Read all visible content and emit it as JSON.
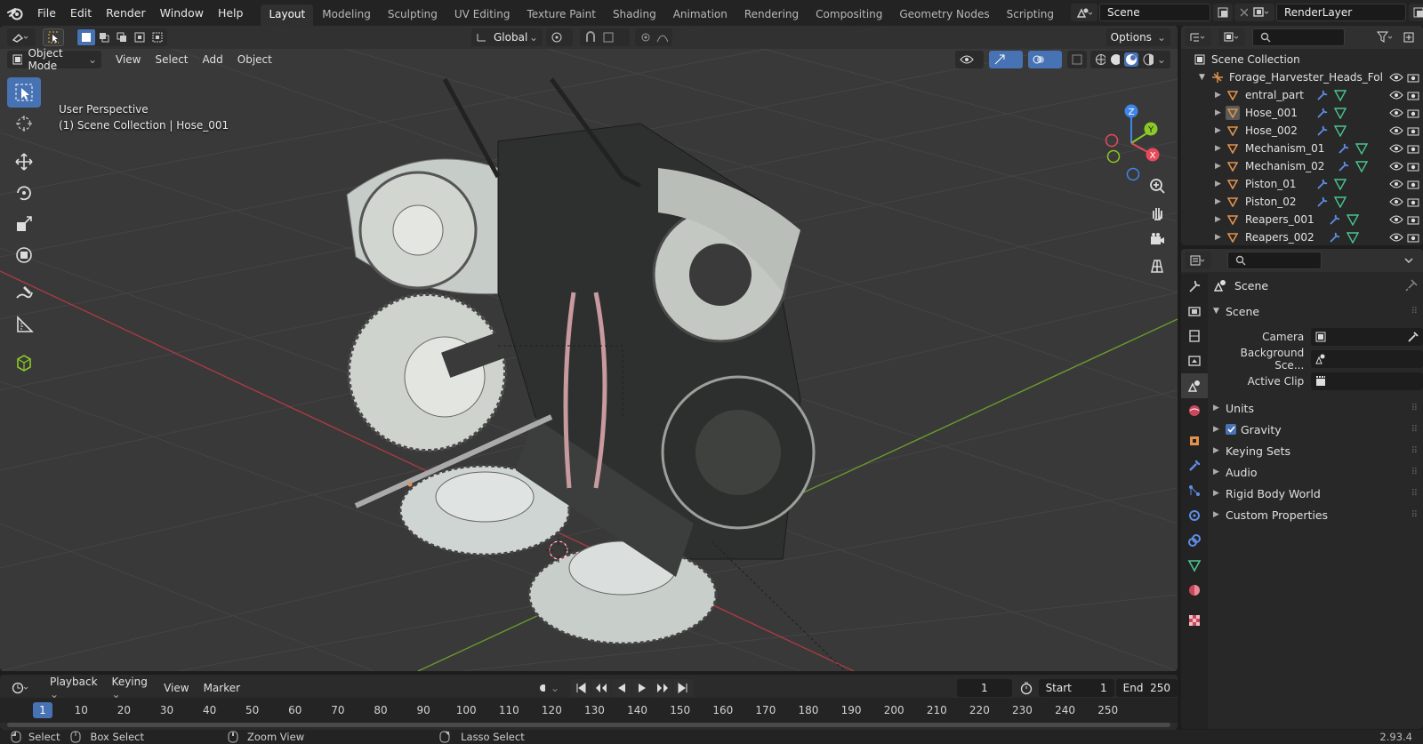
{
  "app": {
    "menus": [
      "File",
      "Edit",
      "Render",
      "Window",
      "Help"
    ]
  },
  "workspaces": [
    "Layout",
    "Modeling",
    "Sculpting",
    "UV Editing",
    "Texture Paint",
    "Shading",
    "Animation",
    "Rendering",
    "Compositing",
    "Geometry Nodes",
    "Scripting"
  ],
  "active_workspace": "Layout",
  "scene_field": "Scene",
  "view_layer_field": "RenderLayer",
  "viewport": {
    "transform_orientation": "Global",
    "options_label": "Options",
    "mode": "Object Mode",
    "menus": [
      "View",
      "Select",
      "Add",
      "Object"
    ],
    "perspective_label": "User Perspective",
    "collection_label": "(1) Scene Collection | Hose_001",
    "gizmo_axes": {
      "x": "X",
      "y": "Y",
      "z": "Z"
    }
  },
  "outliner": {
    "root": "Scene Collection",
    "parent": "Forage_Harvester_Heads_Fol",
    "items": [
      {
        "name": "entral_part",
        "selected": false
      },
      {
        "name": "Hose_001",
        "selected": true
      },
      {
        "name": "Hose_002",
        "selected": false
      },
      {
        "name": "Mechanism_01",
        "selected": false
      },
      {
        "name": "Mechanism_02",
        "selected": false
      },
      {
        "name": "Piston_01",
        "selected": false
      },
      {
        "name": "Piston_02",
        "selected": false
      },
      {
        "name": "Reapers_001",
        "selected": false
      },
      {
        "name": "Reapers_002",
        "selected": false
      }
    ]
  },
  "properties": {
    "context": "Scene",
    "panel": "Scene",
    "fields": [
      {
        "label": "Camera",
        "value": ""
      },
      {
        "label": "Background Sce...",
        "value": ""
      },
      {
        "label": "Active Clip",
        "value": ""
      }
    ],
    "subpanels": [
      "Units",
      "Gravity",
      "Keying Sets",
      "Audio",
      "Rigid Body World",
      "Custom Properties"
    ],
    "gravity_checked": true
  },
  "timeline": {
    "menus": [
      "Playback",
      "Keying",
      "View",
      "Marker"
    ],
    "current_frame": "1",
    "start_label": "Start",
    "start": "1",
    "end_label": "End",
    "end": "250",
    "ruler": [
      "1",
      "10",
      "20",
      "30",
      "40",
      "50",
      "60",
      "70",
      "80",
      "90",
      "100",
      "110",
      "120",
      "130",
      "140",
      "150",
      "160",
      "170",
      "180",
      "190",
      "200",
      "210",
      "220",
      "230",
      "240",
      "250"
    ]
  },
  "status": {
    "select": "Select",
    "box_select": "Box Select",
    "zoom_view": "Zoom View",
    "lasso_select": "Lasso Select",
    "version": "2.93.4"
  },
  "colors": {
    "accent": "#4772b3",
    "x_axis": "#e74b5b",
    "y_axis": "#8ac926",
    "z_axis": "#3f85ea",
    "object_orange": "#e0914b"
  }
}
